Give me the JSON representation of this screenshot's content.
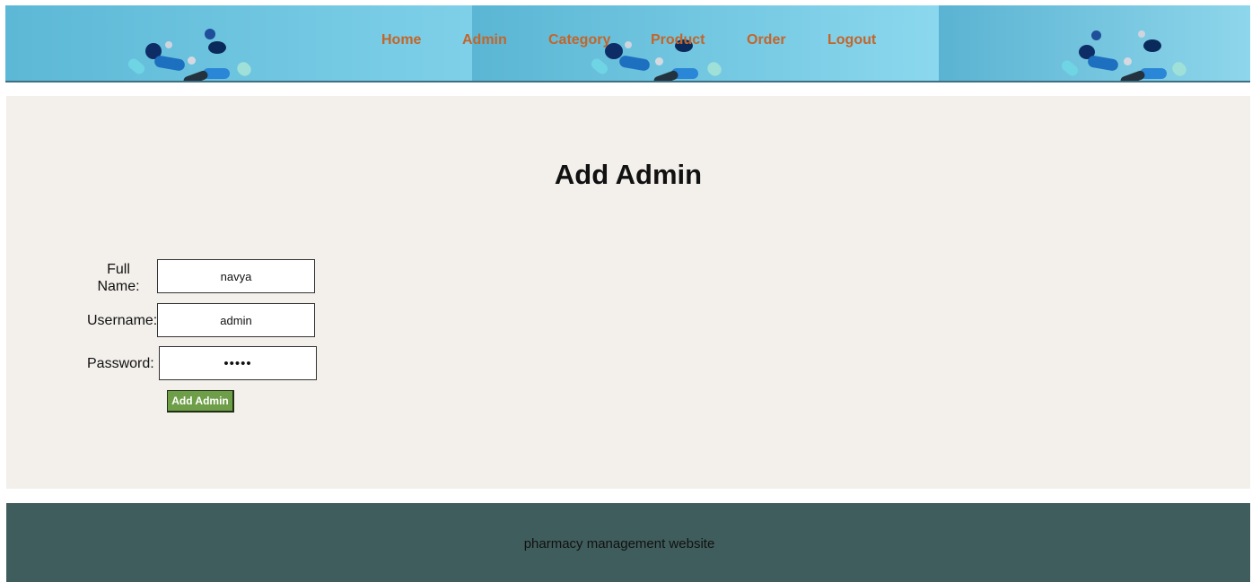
{
  "nav": {
    "items": [
      {
        "label": "Home"
      },
      {
        "label": "Admin"
      },
      {
        "label": "Category"
      },
      {
        "label": "Product"
      },
      {
        "label": "Order"
      },
      {
        "label": "Logout"
      }
    ]
  },
  "main": {
    "title": "Add Admin"
  },
  "form": {
    "full_name": {
      "label": "Full Name:",
      "value": "navya"
    },
    "username": {
      "label": "Username:",
      "value": "admin"
    },
    "password": {
      "label": "Password:",
      "value": "admin"
    },
    "submit_label": "Add Admin"
  },
  "footer": {
    "text": "pharmacy management website"
  },
  "colors": {
    "nav_link": "#c4652a",
    "banner": "#7fcfe6",
    "panel_bg": "#f3f0ec",
    "footer_bg": "#3f5d5c",
    "submit_bg": "#6e9e48"
  },
  "icons": {
    "banner_art": "pills-capsules-image"
  }
}
